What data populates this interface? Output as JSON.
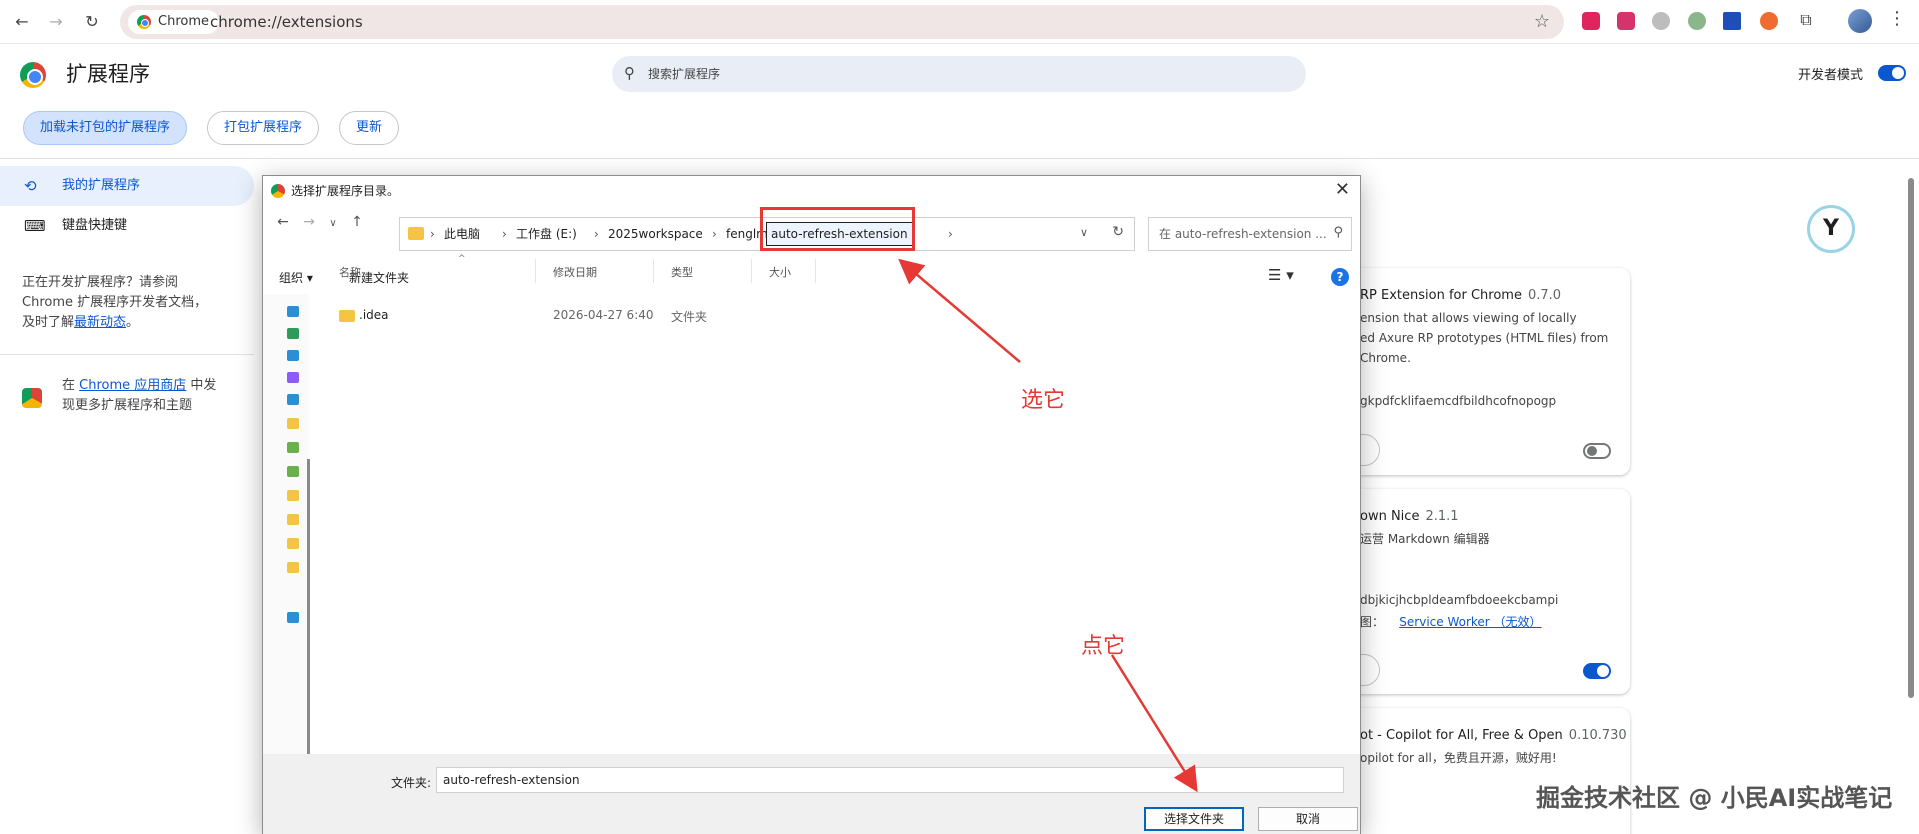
{
  "browser": {
    "tab_chip": "Chrome",
    "url": "chrome://extensions"
  },
  "header": {
    "title": "扩展程序",
    "search_placeholder": "搜索扩展程序",
    "dev_mode_label": "开发者模式",
    "dev_mode_on": true
  },
  "toolbar": {
    "load_unpacked": "加载未打包的扩展程序",
    "pack": "打包扩展程序",
    "update": "更新"
  },
  "sidebar": {
    "items": [
      {
        "label": "我的扩展程序",
        "icon": "puzzle-icon",
        "active": true
      },
      {
        "label": "键盘快捷键",
        "icon": "keyboard-icon",
        "active": false
      }
    ],
    "dev_text_1": "正在开发扩展程序？请参阅",
    "dev_text_2": "Chrome 扩展程序开发者文档，",
    "dev_text_3": "及时了解",
    "dev_link": "最新动态",
    "dev_text_4": "。",
    "store_text_1": "在",
    "store_link": "Chrome 应用商店",
    "store_text_2": "中发",
    "store_text_3": "现更多扩展程序和主题"
  },
  "cards": [
    {
      "name": "RP Extension for Chrome",
      "version": "0.7.0",
      "desc_lines": [
        "ension that allows viewing of locally",
        "ed Axure RP prototypes (HTML files) from",
        " Chrome."
      ],
      "id": "gkpdfcklifaemcdfbildhcofnopogp",
      "enabled": false
    },
    {
      "name": "own Nice",
      "version": "2.1.1",
      "desc_lines": [
        "运营 Markdown 编辑器"
      ],
      "id": "dbjkicjhcbpldeamfbdoeekcbampi",
      "view_prefix": "图：",
      "view_link": "Service Worker （无效）",
      "enabled": true
    },
    {
      "name": "ot - Copilot for All, Free & Open",
      "version": "0.10.730",
      "desc_lines": [
        "opilot for all，免费且开源，贼好用!"
      ],
      "enabled": true
    }
  ],
  "dialog": {
    "title": "选择扩展程序目录。",
    "breadcrumbs": [
      "此电脑",
      "工作盘 (E:)",
      "2025workspace",
      "fenglm",
      "auto-refresh-extension"
    ],
    "search_placeholder": "在 auto-refresh-extension ...",
    "organize": "组织 ▾",
    "new_folder": "新建文件夹",
    "columns": {
      "name": "名称",
      "modified": "修改日期",
      "type": "类型",
      "size": "大小"
    },
    "files": [
      {
        "name": ".idea",
        "modified": "2026-04-27 6:40",
        "type": "文件夹"
      }
    ],
    "folder_label": "文件夹:",
    "folder_value": "auto-refresh-extension",
    "select_button": "选择文件夹",
    "cancel_button": "取消"
  },
  "annotations": {
    "select_it": "选它",
    "click_it": "点它",
    "color": "#e53935"
  },
  "watermark": "掘金技术社区 @ 小民AI实战笔记"
}
